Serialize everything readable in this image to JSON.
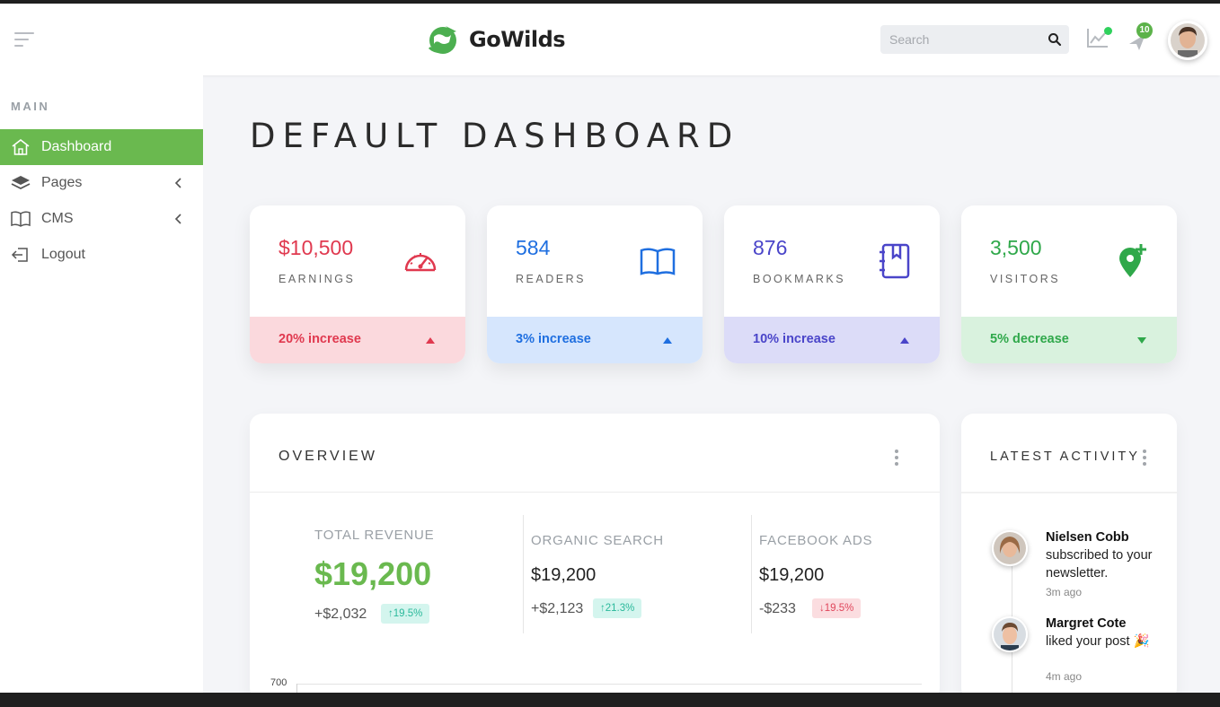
{
  "app": {
    "brand_name": "GoWilds",
    "brand_color": "#4caf50"
  },
  "header": {
    "search_placeholder": "Search",
    "notification_count": "10",
    "icons": [
      "menu-icon",
      "search-icon",
      "trending-chart-icon",
      "rocket-icon"
    ]
  },
  "sidebar": {
    "section_title": "MAIN",
    "items": [
      {
        "label": "Dashboard",
        "icon": "home-icon",
        "active": true
      },
      {
        "label": "Pages",
        "icon": "layers-icon",
        "has_submenu": true
      },
      {
        "label": "CMS",
        "icon": "book-open-icon",
        "has_submenu": true
      },
      {
        "label": "Logout",
        "icon": "logout-icon"
      }
    ]
  },
  "page": {
    "title": "DEFAULT DASHBOARD"
  },
  "stats": [
    {
      "value": "$10,500",
      "label": "EARNINGS",
      "footer": "20% increase",
      "trend": "up",
      "color": "#e0394f",
      "footer_bg": "#fbd9dd",
      "icon": "speedometer-icon"
    },
    {
      "value": "584",
      "label": "READERS",
      "footer": "3% increase",
      "trend": "up",
      "color": "#1f6fe0",
      "footer_bg": "#d6e6fd",
      "icon": "book-icon"
    },
    {
      "value": "876",
      "label": "BOOKMARKS",
      "footer": "10% increase",
      "trend": "up",
      "color": "#4a45c9",
      "footer_bg": "#dcdcf8",
      "icon": "bookmark-notebook-icon"
    },
    {
      "value": "3,500",
      "label": "VISITORS",
      "footer": "5% decrease",
      "trend": "down",
      "color": "#2fa84a",
      "footer_bg": "#d9f2de",
      "icon": "location-add-icon"
    }
  ],
  "overview": {
    "title": "OVERVIEW",
    "total_revenue": {
      "title": "TOTAL REVENUE",
      "value": "$19,200",
      "delta": "+$2,032",
      "badge": "↑19.5%"
    },
    "organic_search": {
      "title": "ORGANIC SEARCH",
      "value": "$19,200",
      "delta": "+$2,123",
      "badge": "↑21.3%"
    },
    "facebook_ads": {
      "title": "FACEBOOK ADS",
      "value": "$19,200",
      "delta": "-$233",
      "badge": "↓19.5%"
    },
    "chart_axis_top": "700"
  },
  "activity": {
    "title": "LATEST ACTIVITY",
    "items": [
      {
        "name": "Nielsen Cobb",
        "text": "subscribed to your newsletter.",
        "time": "3m ago"
      },
      {
        "name": "Margret Cote",
        "text": "liked your post 🎉",
        "time": "4m ago"
      }
    ]
  }
}
